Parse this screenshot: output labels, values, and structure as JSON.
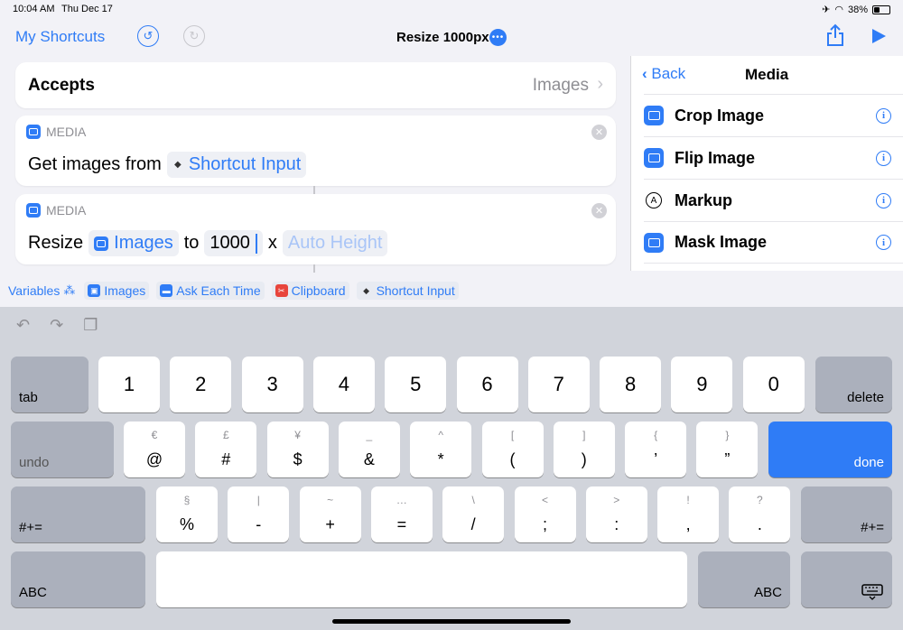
{
  "status": {
    "time": "10:04 AM",
    "date": "Thu Dec 17",
    "battery": "38%"
  },
  "nav": {
    "back": "My Shortcuts",
    "title": "Resize 1000px",
    "more": "•••"
  },
  "accepts": {
    "label": "Accepts",
    "value": "Images"
  },
  "actions": [
    {
      "category": "MEDIA",
      "verb": "Get images from",
      "token": "Shortcut Input"
    },
    {
      "category": "MEDIA",
      "verb": "Resize",
      "token": "Images",
      "to": "to",
      "width": "1000",
      "x": "x",
      "height_placeholder": "Auto Height"
    }
  ],
  "sidebar": {
    "back": "Back",
    "title": "Media",
    "items": [
      {
        "label": "Crop Image"
      },
      {
        "label": "Flip Image"
      },
      {
        "label": "Markup"
      },
      {
        "label": "Mask Image"
      }
    ]
  },
  "variables": {
    "label": "Variables",
    "chips": [
      "Images",
      "Ask Each Time",
      "Clipboard",
      "Shortcut Input"
    ]
  },
  "keyboard": {
    "row1": [
      "1",
      "2",
      "3",
      "4",
      "5",
      "6",
      "7",
      "8",
      "9",
      "0"
    ],
    "row2": [
      [
        "€",
        "@"
      ],
      [
        "£",
        "#"
      ],
      [
        "¥",
        "$"
      ],
      [
        "_",
        "&"
      ],
      [
        "^",
        "*"
      ],
      [
        "[",
        "("
      ],
      [
        "]",
        ")"
      ],
      [
        "{",
        "’"
      ],
      [
        "}",
        "”"
      ]
    ],
    "row3": [
      [
        "§",
        "%"
      ],
      [
        "|",
        "-"
      ],
      [
        "~",
        "+"
      ],
      [
        "…",
        "="
      ],
      [
        "\\",
        "/"
      ],
      [
        "<",
        ";"
      ],
      [
        ">",
        ":"
      ],
      [
        "!",
        ","
      ],
      [
        "?",
        "."
      ]
    ],
    "tab": "tab",
    "delete": "delete",
    "undo": "undo",
    "done": "done",
    "sym": "#+=",
    "abc": "ABC"
  }
}
